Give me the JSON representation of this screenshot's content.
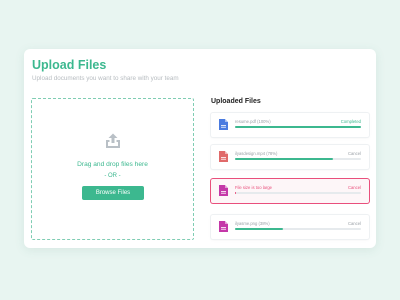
{
  "header": {
    "title": "Upload Files",
    "subtitle": "Upload documents you want to share with your team"
  },
  "dropzone": {
    "icon": "upload-icon",
    "text": "Drag and drop files here",
    "or_text": "- OR -",
    "browse_label": "Browse Files"
  },
  "uploaded": {
    "title": "Uploaded Files",
    "files": [
      {
        "name": "resume.pdf (100%)",
        "action": "Completed",
        "progress": 1.0,
        "status": "completed",
        "icon": "file-icon",
        "icon_color": "#4a7be0"
      },
      {
        "name": "ilyasdesign.mp4 (78%)",
        "action": "Cancel",
        "progress": 0.78,
        "status": "uploading",
        "icon": "file-icon",
        "icon_color": "#e06a6a"
      },
      {
        "name": "File size is too large",
        "action": "Cancel",
        "progress": 0.01,
        "status": "error",
        "icon": "file-icon",
        "icon_color": "#c438a8"
      },
      {
        "name": "ilyasme.png (38%)",
        "action": "Cancel",
        "progress": 0.38,
        "status": "uploading",
        "icon": "file-icon",
        "icon_color": "#c438a8"
      }
    ]
  },
  "colors": {
    "accent": "#3cb88f",
    "error": "#e94f7c",
    "background": "#e8f5f1"
  }
}
